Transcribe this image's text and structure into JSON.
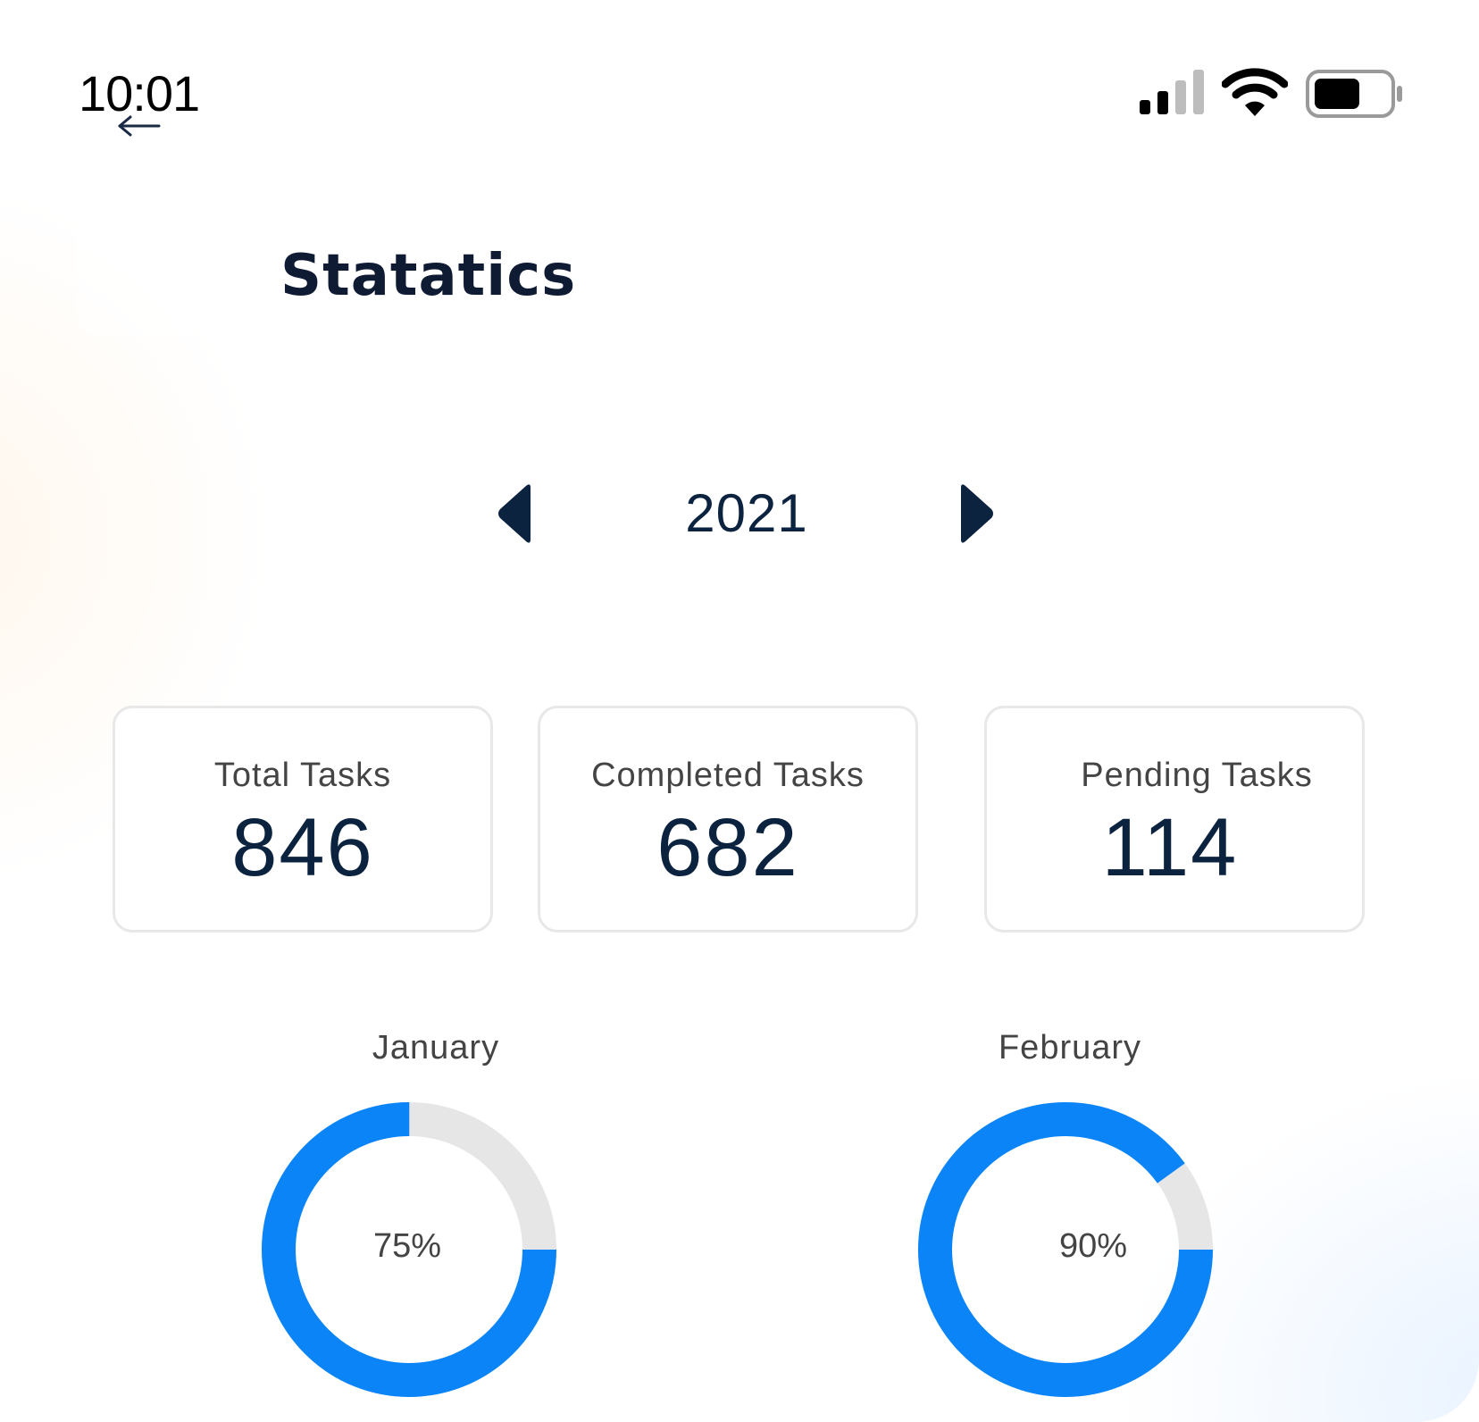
{
  "status_bar": {
    "time": "10:01",
    "icons": [
      "back-arrow-icon",
      "cellular-signal-icon",
      "wifi-icon",
      "battery-icon"
    ]
  },
  "header": {
    "title": "Statatics"
  },
  "year_selector": {
    "year": "2021",
    "prev_icon": "triangle-left-icon",
    "next_icon": "triangle-right-icon"
  },
  "stats": {
    "total": {
      "label": "Total Tasks",
      "value": "846"
    },
    "completed": {
      "label": "Completed Tasks",
      "value": "682"
    },
    "pending": {
      "label": "Pending Tasks",
      "value": "114"
    }
  },
  "monthly_progress": [
    {
      "month": "January",
      "percent_label": "75%",
      "percent": 75
    },
    {
      "month": "February",
      "percent_label": "90%",
      "percent": 90
    }
  ],
  "colors": {
    "accent": "#0a84f7",
    "track": "#e6e6e6",
    "primary_text": "#0c2340",
    "secondary_text": "#444444"
  }
}
